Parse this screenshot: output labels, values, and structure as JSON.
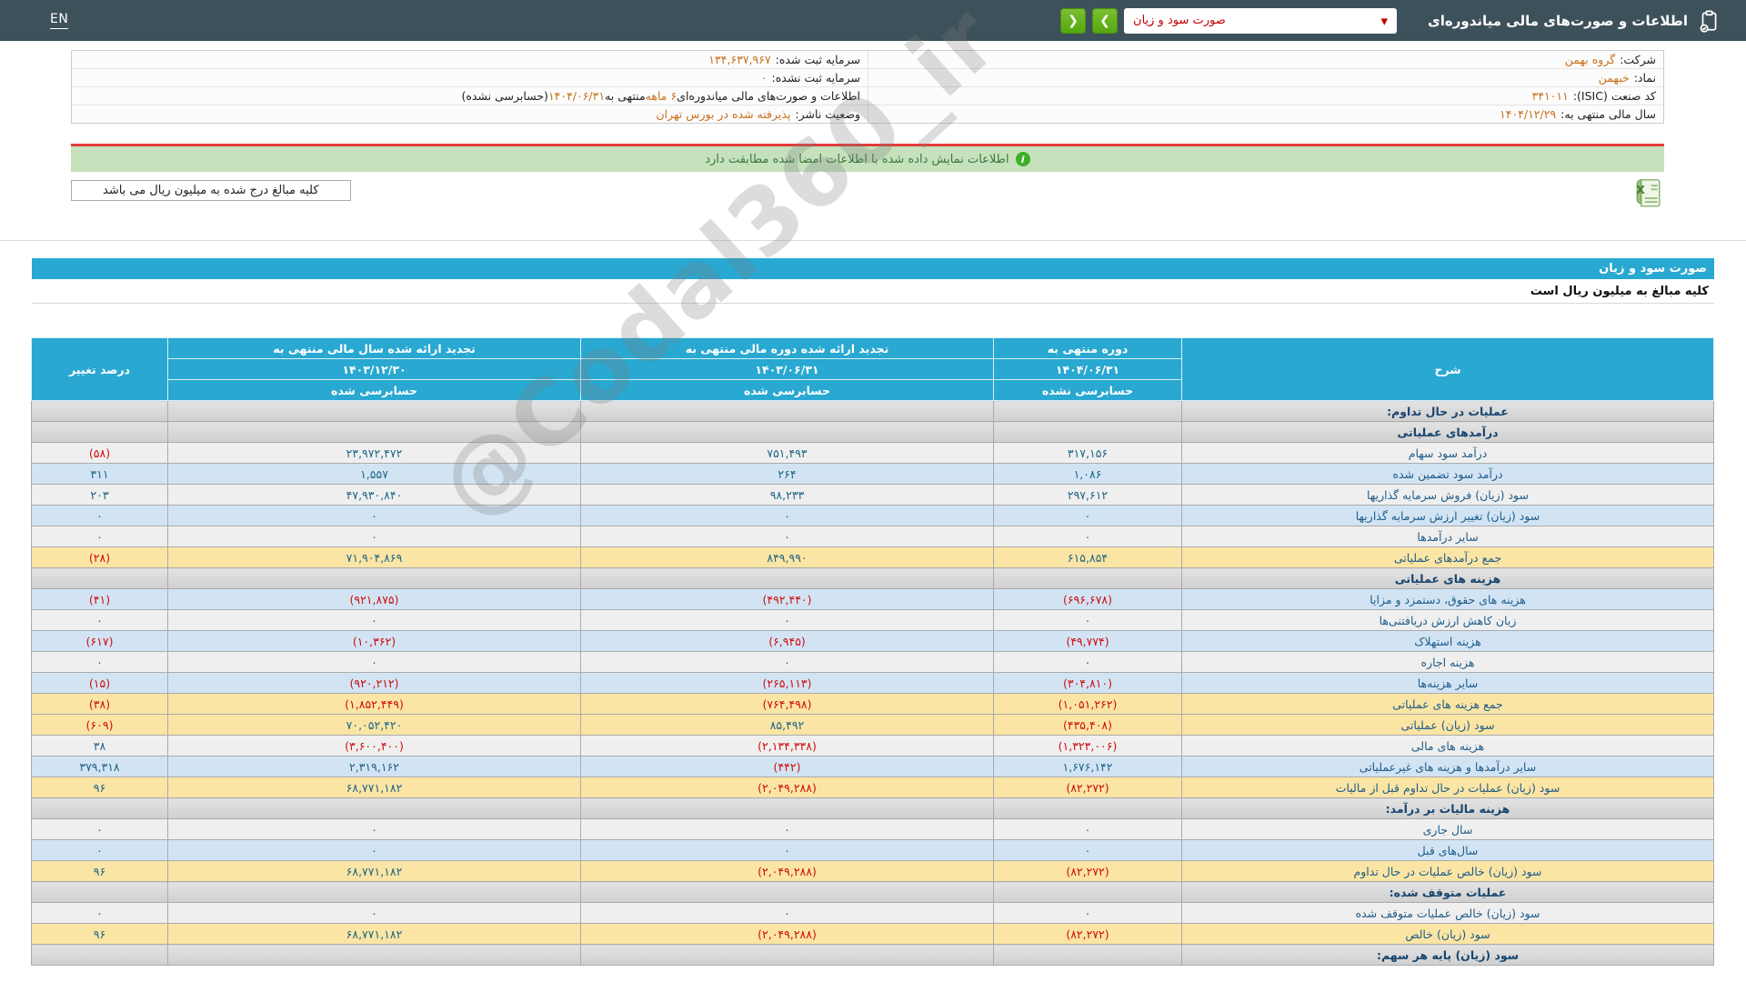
{
  "topbar": {
    "en_label": "EN",
    "title": "اطلاعات و صورت‌های مالی میاندوره‌ای",
    "selected_report": "صورت سود و زیان",
    "caret": "▾",
    "next_glyph": "❯",
    "prev_glyph": "❮"
  },
  "company_info": {
    "rows": [
      {
        "r_label": "شرکت:",
        "r_value": "گروه بهمن",
        "l_label": "سرمایه ثبت شده:",
        "l_value": "۱۳۴,۶۳۷,۹۶۷"
      },
      {
        "r_label": "نماد:",
        "r_value": "خبهمن",
        "l_label": "سرمایه ثبت نشده:",
        "l_value": "۰"
      },
      {
        "r_label": "کد صنعت (ISIC):",
        "r_value": "۳۴۱۰۱۱"
      },
      {
        "r_label": "سال مالی منتهی به:",
        "r_value": "۱۴۰۴/۱۲/۲۹",
        "l_label": "وضعیت ناشر:",
        "l_value": "پذیرفته شده در بورس تهران"
      }
    ],
    "period_statement": {
      "prefix": "اطلاعات و صورت‌های مالی میاندوره‌ای ",
      "months": "۶ ماهه",
      "middle": " منتهی به ",
      "date": "۱۴۰۴/۰۶/۳۱",
      "suffix": "(حسابرسی نشده)"
    }
  },
  "notices": {
    "signature_match": "اطلاعات نمایش داده شده با اطلاعات امضا شده مطابقت دارد",
    "info_glyph": "i",
    "amounts_note": "کلیه مبالغ درج شده به میلیون ریال می باشد"
  },
  "statement": {
    "title": "صورت سود و زیان",
    "unit_note": "کلیه مبالغ به میلیون ریال است",
    "header": {
      "desc": "شرح",
      "change": "درصد تغییر",
      "current": {
        "title": "دوره منتهی به",
        "date": "۱۴۰۴/۰۶/۳۱",
        "audit": "حسابرسی نشده"
      },
      "restated_period": {
        "title": "تجدید ارائه شده دوره مالی منتهی به",
        "date": "۱۴۰۳/۰۶/۳۱",
        "audit": "حسابرسی شده"
      },
      "restated_year": {
        "title": "تجدید ارائه شده سال مالی منتهی به",
        "date": "۱۴۰۳/۱۲/۳۰",
        "audit": "حسابرسی شده"
      }
    },
    "rows": [
      {
        "type": "section",
        "label": "عملیات در حال تداوم:"
      },
      {
        "type": "section",
        "label": "درآمدهای عملیاتی"
      },
      {
        "type": "data",
        "shade": "a",
        "label": "درآمد سود سهام",
        "current": "۳۱۷,۱۵۶",
        "prev_period": "۷۵۱,۴۹۳",
        "prev_year": "۲۳,۹۷۲,۴۷۲",
        "change": "(۵۸)"
      },
      {
        "type": "data",
        "shade": "b",
        "label": "درآمد سود تضمین شده",
        "current": "۱,۰۸۶",
        "prev_period": "۲۶۴",
        "prev_year": "۱,۵۵۷",
        "change": "۳۱۱"
      },
      {
        "type": "data",
        "shade": "a",
        "label": "سود (زیان) فروش سرمایه گذاریها",
        "current": "۲۹۷,۶۱۲",
        "prev_period": "۹۸,۲۳۳",
        "prev_year": "۴۷,۹۳۰,۸۴۰",
        "change": "۲۰۳"
      },
      {
        "type": "data",
        "shade": "b",
        "label": "سود (زیان) تغییر ارزش سرمایه گذاریها",
        "current": "۰",
        "prev_period": "۰",
        "prev_year": "۰",
        "change": "۰"
      },
      {
        "type": "data",
        "shade": "a",
        "label": "سایر درآمدها",
        "current": "۰",
        "prev_period": "۰",
        "prev_year": "۰",
        "change": "۰"
      },
      {
        "type": "total",
        "label": "جمع درآمدهای عملیاتی",
        "current": "۶۱۵,۸۵۴",
        "prev_period": "۸۴۹,۹۹۰",
        "prev_year": "۷۱,۹۰۴,۸۶۹",
        "change": "(۲۸)"
      },
      {
        "type": "section",
        "label": "هزینه های عملیاتی"
      },
      {
        "type": "data",
        "shade": "b",
        "label": "هزینه های حقوق، دستمزد و مزایا",
        "current": "(۶۹۶,۶۷۸)",
        "prev_period": "(۴۹۲,۴۴۰)",
        "prev_year": "(۹۲۱,۸۷۵)",
        "change": "(۴۱)"
      },
      {
        "type": "data",
        "shade": "a",
        "label": "زیان کاهش ارزش دریافتنی‌ها",
        "current": "۰",
        "prev_period": "۰",
        "prev_year": "۰",
        "change": "۰"
      },
      {
        "type": "data",
        "shade": "b",
        "label": "هزینه استهلاک",
        "current": "(۴۹,۷۷۴)",
        "prev_period": "(۶,۹۴۵)",
        "prev_year": "(۱۰,۳۶۲)",
        "change": "(۶۱۷)"
      },
      {
        "type": "data",
        "shade": "a",
        "label": "هزینه اجاره",
        "current": "۰",
        "prev_period": "۰",
        "prev_year": "۰",
        "change": "۰"
      },
      {
        "type": "data",
        "shade": "b",
        "label": "سایر هزینه‌ها",
        "current": "(۳۰۴,۸۱۰)",
        "prev_period": "(۲۶۵,۱۱۳)",
        "prev_year": "(۹۲۰,۲۱۲)",
        "change": "(۱۵)"
      },
      {
        "type": "total",
        "label": "جمع هزینه های عملیاتی",
        "current": "(۱,۰۵۱,۲۶۲)",
        "prev_period": "(۷۶۴,۴۹۸)",
        "prev_year": "(۱,۸۵۲,۴۴۹)",
        "change": "(۳۸)"
      },
      {
        "type": "total",
        "label": "سود (زیان) عملیاتی",
        "current": "(۴۳۵,۴۰۸)",
        "prev_period": "۸۵,۴۹۲",
        "prev_year": "۷۰,۰۵۲,۴۲۰",
        "change": "(۶۰۹)"
      },
      {
        "type": "data",
        "shade": "a",
        "label": "هزینه های مالی",
        "current": "(۱,۳۲۳,۰۰۶)",
        "prev_period": "(۲,۱۳۴,۳۳۸)",
        "prev_year": "(۳,۶۰۰,۴۰۰)",
        "change": "۳۸"
      },
      {
        "type": "data",
        "shade": "b",
        "label": "سایر درآمدها و هزینه های غیرعملیاتی",
        "current": "۱,۶۷۶,۱۴۲",
        "prev_period": "(۴۴۲)",
        "prev_year": "۲,۳۱۹,۱۶۲",
        "change": "۳۷۹,۳۱۸"
      },
      {
        "type": "total",
        "label": "سود (زیان) عملیات در حال تداوم قبل از مالیات",
        "current": "(۸۲,۲۷۲)",
        "prev_period": "(۲,۰۴۹,۲۸۸)",
        "prev_year": "۶۸,۷۷۱,۱۸۲",
        "change": "۹۶"
      },
      {
        "type": "section",
        "label": "هزینه مالیات بر درآمد:"
      },
      {
        "type": "data",
        "shade": "a",
        "label": "سال جاری",
        "current": "۰",
        "prev_period": "۰",
        "prev_year": "۰",
        "change": "۰"
      },
      {
        "type": "data",
        "shade": "b",
        "label": "سال‌های قبل",
        "current": "۰",
        "prev_period": "۰",
        "prev_year": "۰",
        "change": "۰"
      },
      {
        "type": "total",
        "label": "سود (زیان) خالص عملیات در حال تداوم",
        "current": "(۸۲,۲۷۲)",
        "prev_period": "(۲,۰۴۹,۲۸۸)",
        "prev_year": "۶۸,۷۷۱,۱۸۲",
        "change": "۹۶"
      },
      {
        "type": "section",
        "label": "عملیات متوقف شده:"
      },
      {
        "type": "data",
        "shade": "a",
        "label": "سود (زیان) خالص عملیات متوقف شده",
        "current": "۰",
        "prev_period": "۰",
        "prev_year": "۰",
        "change": "۰"
      },
      {
        "type": "total",
        "label": "سود (زیان) خالص",
        "current": "(۸۲,۲۷۲)",
        "prev_period": "(۲,۰۴۹,۲۸۸)",
        "prev_year": "۶۸,۷۷۱,۱۸۲",
        "change": "۹۶"
      },
      {
        "type": "section",
        "label": "سود (زیان) پایه هر سهم:"
      }
    ]
  },
  "watermark": "@Codal360_ir",
  "colors": {
    "topbar": "#3d515b",
    "accent_blue": "#29a8d1",
    "button_green": "#55a80f",
    "value_orange": "#c9721e",
    "positive_number": "#1e6687",
    "negative_number": "#cf0e0e",
    "total_row": "#fbe5a4",
    "alt_row_blue": "#d2e4f4",
    "section_row": "#d6d6d6",
    "notice_green": "#c5e2bc",
    "red_line": "#e23c39"
  }
}
